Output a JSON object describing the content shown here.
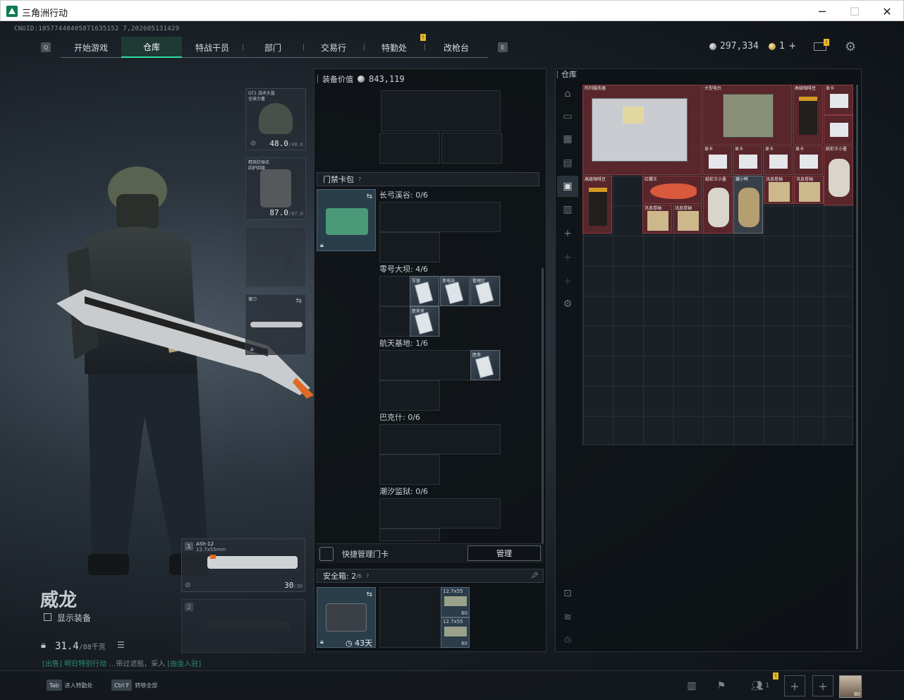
{
  "window": {
    "title": "三角洲行动"
  },
  "uid": "CNUID:18577440405871635152 7,202605131429",
  "nav": {
    "tabs": [
      "开始游戏",
      "仓库",
      "特战干员",
      "部门",
      "交易行",
      "特勤处",
      "改枪台"
    ],
    "active": "仓库",
    "left_key": "Q",
    "right_key": "E"
  },
  "currency": {
    "coins": "297,334",
    "gold": "1"
  },
  "operator": {
    "name": "威龙",
    "show_equipment": "显示装备",
    "weight": "31.4",
    "weight_max": "/88千克",
    "hint_left": "[出售]",
    "hint_mid": "明日特别行动",
    "hint_tail": "…带过滤瓶，采入",
    "hint_right": "[由坐入驻]"
  },
  "equip": {
    "helmet": {
      "label": "GT1 战术头盔",
      "sub": "全球力量",
      "durability": "48.0",
      "max": "/48.0"
    },
    "armor": {
      "label": "精英防弹衣",
      "sub": "四护四级",
      "durability": "87.0",
      "max": "/87.0"
    },
    "melee": {
      "label": "镰刀"
    },
    "weapon1": {
      "num": "1",
      "name": "ASh-12",
      "caliber": "12.7x55mm",
      "ammo": "30",
      "ammo_max": "/30"
    },
    "weapon2": {
      "num": "2"
    }
  },
  "middle": {
    "value_label": "装备价值",
    "value": "843,119",
    "keycard_title": "门禁卡包",
    "maps": [
      {
        "name": "长弓溪谷: 0/6",
        "cards": []
      },
      {
        "name": "零号大坝: 4/6",
        "cards": [
          "军营",
          "变电站",
          "管理区",
          "医务室"
        ]
      },
      {
        "name": "航天基地: 1/6",
        "cards": [
          "医务"
        ]
      },
      {
        "name": "巴克什: 0/6",
        "cards": []
      },
      {
        "name": "潮汐监狱: 0/6",
        "cards": []
      }
    ],
    "quick_manage": "快捷管理门卡",
    "manage_button": "管理",
    "safebox_label": "安全箱:",
    "safebox_count": "2",
    "safebox_max": "/6",
    "safebox_days": "43天",
    "ammo": [
      {
        "label": "12.7x55",
        "count": "60"
      },
      {
        "label": "12.7x55",
        "count": "60"
      }
    ]
  },
  "warehouse": {
    "title": "仓库",
    "items": [
      "阵列服务器",
      "大型电台",
      "高级咖啡豆",
      "显卡",
      "显卡",
      "显卡",
      "显卡",
      "显卡",
      "显卡",
      "纸彩王小墨",
      "高级咖啡豆",
      "红螺王",
      "纸彩王小墨",
      "藏小鸭",
      "讯息卷轴",
      "讯息卷轴",
      "讯息卷轴",
      "讯息卷轴"
    ]
  },
  "bottom": {
    "keys": [
      {
        "key": "Tab",
        "label": "进入特勤处"
      },
      {
        "key": "Ctrl F",
        "label": "转移全部"
      }
    ],
    "friends": "1",
    "avatar_level": "80"
  },
  "colors": {
    "accent": "#2fe0a0",
    "item_red": "#6e282d",
    "badge": "#e5b727"
  }
}
